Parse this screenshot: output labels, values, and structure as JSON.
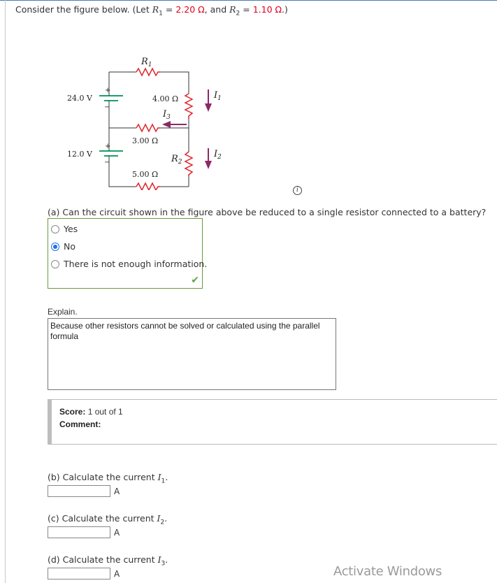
{
  "intro": {
    "prefix": "Consider the figure below. (Let ",
    "r1_symbol": "R",
    "r1_sub": "1",
    "r1_eq": " = ",
    "r1_value": "2.20 Ω",
    "mid": ", and ",
    "r2_symbol": "R",
    "r2_sub": "2",
    "r2_eq": " = ",
    "r2_value": "1.10 Ω",
    "suffix": ".)"
  },
  "colors": {
    "given_values": "#e0001b",
    "correct_border": "#6a9a3a",
    "check": "#5aa641",
    "resistor": "#e0222a",
    "battery": "#1aa06a",
    "arrow": "#8b2a66",
    "radio_selected": "#1a73e8"
  },
  "circuit": {
    "battery_top": "24.0 V",
    "battery_bottom": "12.0 V",
    "r1_label": "R",
    "r1_sub": "1",
    "r_4": "4.00 Ω",
    "r_3": "3.00 Ω",
    "r_5": "5.00 Ω",
    "r2_label": "R",
    "r2_sub": "2",
    "i1_label": "I",
    "i1_sub": "1",
    "i2_label": "I",
    "i2_sub": "2",
    "i3_label": "I",
    "i3_sub": "3",
    "plus": "+",
    "minus": "−"
  },
  "info_icon": "i",
  "part_a": {
    "question": "(a) Can the circuit shown in the figure above be reduced to a single resistor connected to a battery?",
    "options": [
      {
        "label": "Yes",
        "selected": false
      },
      {
        "label": "No",
        "selected": true
      },
      {
        "label": "There is not enough information.",
        "selected": false
      }
    ],
    "result_icon": "check-icon",
    "result_glyph": "✔"
  },
  "explain": {
    "label": "Explain.",
    "value": "Because other resistors cannot be solved or calculated using the parallel formula"
  },
  "score": {
    "label": "Score:",
    "value": " 1 out of 1",
    "comment_label": "Comment:"
  },
  "part_b": {
    "prefix": "(b) Calculate the current ",
    "var": "I",
    "sub": "1",
    "suffix": ".",
    "value": "",
    "unit": "A"
  },
  "part_c": {
    "prefix": "(c) Calculate the current ",
    "var": "I",
    "sub": "2",
    "suffix": ".",
    "value": "",
    "unit": "A"
  },
  "part_d": {
    "prefix": "(d) Calculate the current ",
    "var": "I",
    "sub": "3",
    "suffix": ".",
    "value": "",
    "unit": "A"
  },
  "watermark": "Activate Windows"
}
